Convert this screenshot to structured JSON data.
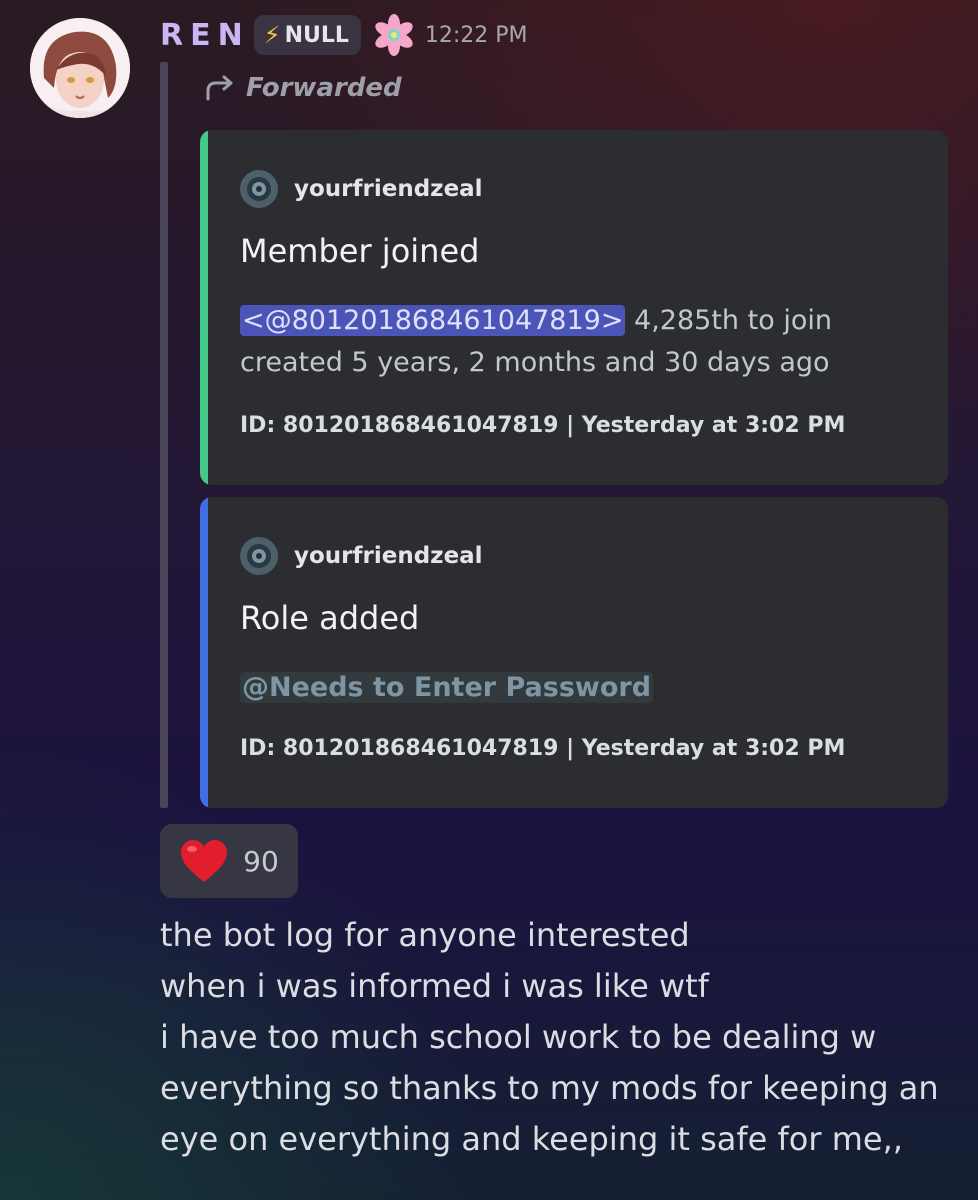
{
  "message": {
    "author": "REN",
    "tag": {
      "icon": "lightning-bolt-icon",
      "label": "NULL"
    },
    "badge_icon": "flower-icon",
    "timestamp": "12:22 PM",
    "forwarded_label": "Forwarded",
    "embeds": [
      {
        "accent_color": "#43c88a",
        "author": "yourfriendzeal",
        "title": "Member joined",
        "mention": "<@801201868461047819>",
        "mention_suffix": " 4,285th to join",
        "line2": "created 5 years, 2 months and 30 days ago",
        "footer": "ID: 801201868461047819 | Yesterday at 3:02 PM"
      },
      {
        "accent_color": "#3f6fe0",
        "author": "yourfriendzeal",
        "title": "Role added",
        "role_mention": "@Needs to Enter Password",
        "footer": "ID: 801201868461047819 | Yesterday at 3:02 PM"
      }
    ],
    "reaction": {
      "emoji": "heart-icon",
      "count": "90"
    },
    "content_lines": [
      "the bot log for anyone interested",
      "when i was informed i was like wtf",
      "i have too much school work to be dealing w",
      "everything so thanks to my mods for keeping an",
      "eye on everything and keeping it safe for me,,"
    ]
  }
}
